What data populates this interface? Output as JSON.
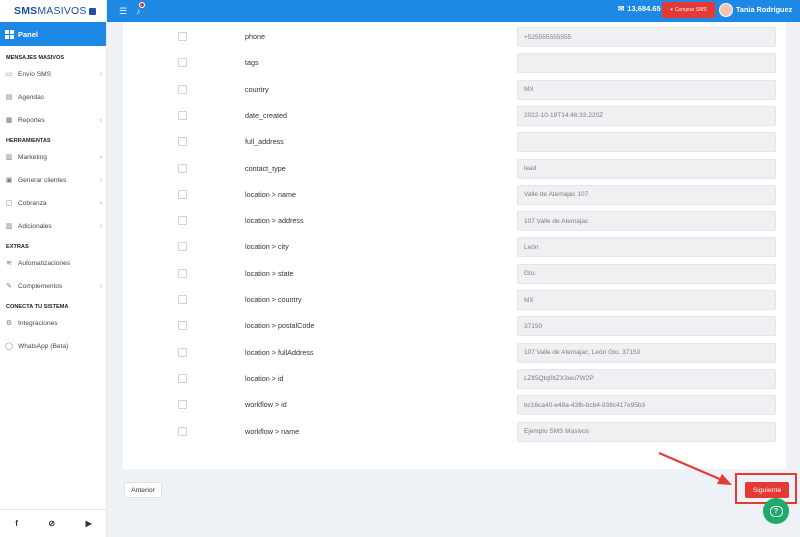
{
  "brand": {
    "part1": "SMS",
    "part2": "MASIVOS"
  },
  "sidebar": {
    "panel_label": "Panel",
    "sections": {
      "mensajes": "MENSAJES MASIVOS",
      "herramientas": "HERRAMIENTAS",
      "extras": "EXTRAS",
      "conecta": "CONECTA TU SISTEMA"
    },
    "items": {
      "envio_sms": "Envío SMS",
      "agendas": "Agendas",
      "reportes": "Reportes",
      "marketing": "Marketing",
      "generar_clientes": "Generar clientes",
      "cobranza": "Cobranza",
      "adicionales": "Adicionales",
      "automatizaciones": "Automatizaciones",
      "complementos": "Complementos",
      "integraciones": "Integraciones",
      "whatsapp": "WhatsApp (Beta)"
    },
    "icons": [
      "facebook-icon",
      "help-circle-icon",
      "youtube-icon"
    ]
  },
  "topbar": {
    "credits": "13,684.65",
    "buy_label": "Comprar SMS",
    "user_name": "Tania Rodríguez"
  },
  "fields": [
    {
      "name": "phone",
      "value": "+525555555555"
    },
    {
      "name": "tags",
      "value": ""
    },
    {
      "name": "country",
      "value": "MX"
    },
    {
      "name": "date_created",
      "value": "2022-10-19T14:46:33.220Z"
    },
    {
      "name": "full_address",
      "value": ""
    },
    {
      "name": "contact_type",
      "value": "lead"
    },
    {
      "name": "location > name",
      "value": "Valle de Atemajac 107"
    },
    {
      "name": "location > address",
      "value": "107 Valle de Atemajac"
    },
    {
      "name": "location > city",
      "value": "León"
    },
    {
      "name": "location > state",
      "value": "Gto."
    },
    {
      "name": "location > country",
      "value": "MX"
    },
    {
      "name": "location > postalCode",
      "value": "37150"
    },
    {
      "name": "location > fullAddress",
      "value": "107 Valle de Atemajac, León Gto. 37150"
    },
    {
      "name": "location > id",
      "value": "LZlt5Qtq0ltZX3wu7W2P"
    },
    {
      "name": "workflow > id",
      "value": "bc16ca40-e48a-43fb-bcb4-938c417e95b3"
    },
    {
      "name": "workflow > name",
      "value": "Ejemplo SMS Masivos"
    }
  ],
  "buttons": {
    "prev": "Anterior",
    "next": "Siguiente",
    "help": "?"
  },
  "colors": {
    "primary": "#1e88e5",
    "danger": "#e53935",
    "help": "#1faa6c"
  }
}
